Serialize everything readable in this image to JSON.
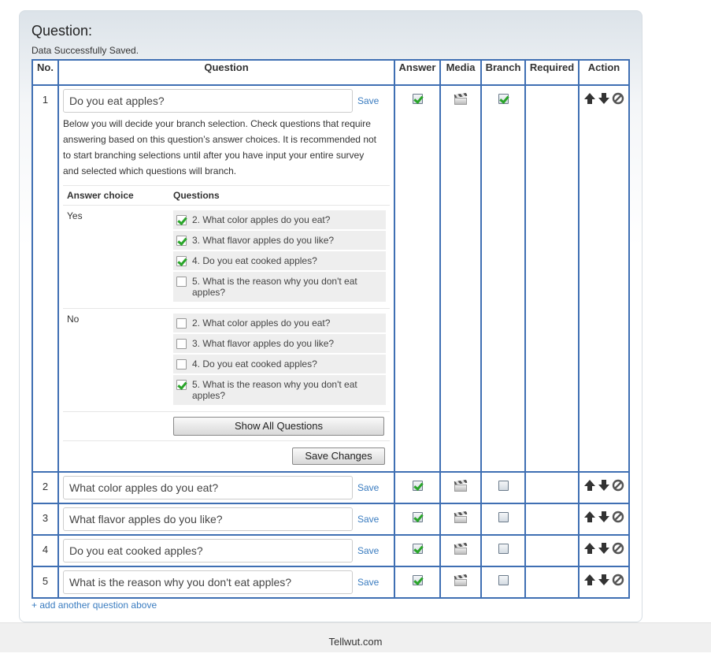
{
  "title": "Question:",
  "status": "Data Successfully Saved.",
  "columns": [
    "No.",
    "Question",
    "Answer",
    "Media",
    "Branch",
    "Required",
    "Action"
  ],
  "save_label": "Save",
  "questions": [
    {
      "no": "1",
      "text": "Do you eat apples?",
      "answer": true,
      "branch": true
    },
    {
      "no": "2",
      "text": "What color apples do you eat?",
      "answer": true,
      "branch": false
    },
    {
      "no": "3",
      "text": "What flavor apples do you like?",
      "answer": true,
      "branch": false
    },
    {
      "no": "4",
      "text": "Do you eat cooked apples?",
      "answer": true,
      "branch": false
    },
    {
      "no": "5",
      "text": "What is the reason why you don't eat apples?",
      "answer": true,
      "branch": false
    }
  ],
  "branch_desc": "Below you will decide your branch selection. Check questions that require answering based on this question’s answer choices. It is recommended not to start branching selections until after you have input your entire survey and selected which questions will branch.",
  "branch_headers": {
    "choice": "Answer choice",
    "questions": "Questions"
  },
  "branch_choices": [
    {
      "label": "Yes",
      "items": [
        {
          "text": "2. What color apples do you eat?",
          "checked": true
        },
        {
          "text": "3. What flavor apples do you like?",
          "checked": true
        },
        {
          "text": "4. Do you eat cooked apples?",
          "checked": true
        },
        {
          "text": "5. What is the reason why you don't eat apples?",
          "checked": false
        }
      ]
    },
    {
      "label": "No",
      "items": [
        {
          "text": "2. What color apples do you eat?",
          "checked": false
        },
        {
          "text": "3. What flavor apples do you like?",
          "checked": false
        },
        {
          "text": "4. Do you eat cooked apples?",
          "checked": false
        },
        {
          "text": "5. What is the reason why you don't eat apples?",
          "checked": true
        }
      ]
    }
  ],
  "show_all_label": "Show All Questions",
  "save_changes_label": "Save Changes",
  "add_question_label": "+ add another question above",
  "footer": "Tellwut.com",
  "icons": {
    "answer": "checkbox-checked-icon",
    "media": "clapperboard-icon",
    "actions": [
      "arrow-up-icon",
      "arrow-down-icon",
      "delete-icon"
    ]
  }
}
